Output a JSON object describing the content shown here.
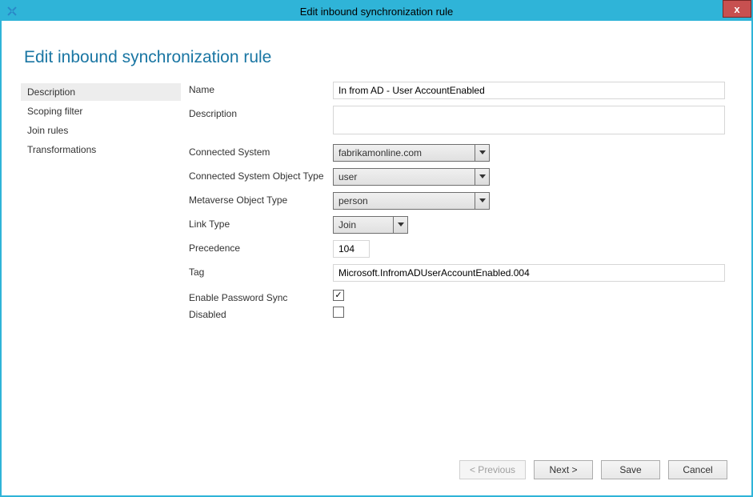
{
  "window": {
    "title": "Edit inbound synchronization rule",
    "close": "x"
  },
  "heading": "Edit inbound synchronization rule",
  "sidebar": {
    "items": [
      {
        "label": "Description",
        "active": true
      },
      {
        "label": "Scoping filter",
        "active": false
      },
      {
        "label": "Join rules",
        "active": false
      },
      {
        "label": "Transformations",
        "active": false
      }
    ]
  },
  "form": {
    "name_label": "Name",
    "name_value": "In from AD - User AccountEnabled",
    "description_label": "Description",
    "description_value": "",
    "connected_system_label": "Connected System",
    "connected_system_value": "fabrikamonline.com",
    "cs_object_type_label": "Connected System Object Type",
    "cs_object_type_value": "user",
    "mv_object_type_label": "Metaverse Object Type",
    "mv_object_type_value": "person",
    "link_type_label": "Link Type",
    "link_type_value": "Join",
    "precedence_label": "Precedence",
    "precedence_value": "104",
    "tag_label": "Tag",
    "tag_value": "Microsoft.InfromADUserAccountEnabled.004",
    "enable_pwd_sync_label": "Enable Password Sync",
    "enable_pwd_sync_checked": true,
    "disabled_label": "Disabled",
    "disabled_checked": false
  },
  "footer": {
    "previous": "< Previous",
    "next": "Next >",
    "save": "Save",
    "cancel": "Cancel"
  }
}
